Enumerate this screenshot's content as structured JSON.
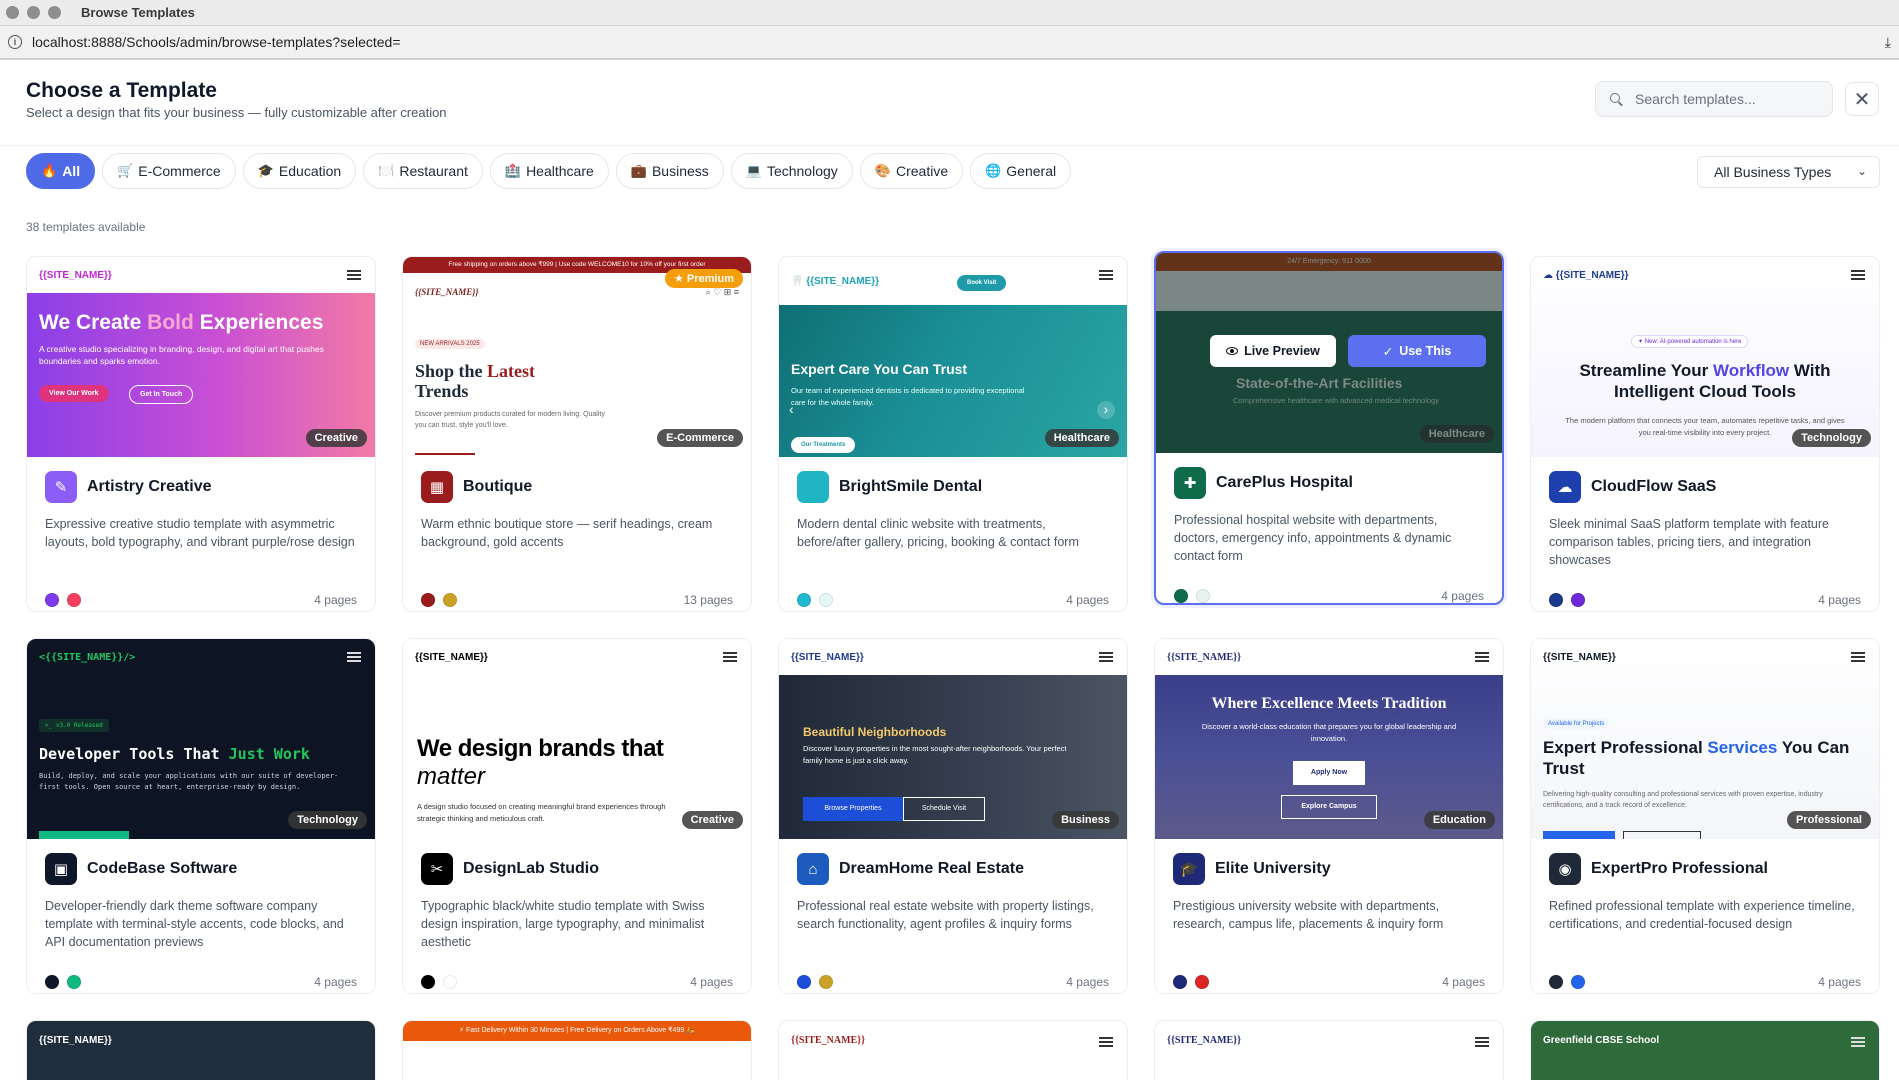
{
  "window": {
    "title": "Browse Templates",
    "url": "localhost:8888/Schools/admin/browse-templates?selected="
  },
  "header": {
    "title": "Choose a Template",
    "subtitle": "Select a design that fits your business — fully customizable after creation",
    "search_placeholder": "Search templates...",
    "close_label": "✕"
  },
  "filters": [
    {
      "emoji": "🔥",
      "label": "All"
    },
    {
      "emoji": "🛒",
      "label": "E-Commerce"
    },
    {
      "emoji": "🎓",
      "label": "Education"
    },
    {
      "emoji": "🍽️",
      "label": "Restaurant"
    },
    {
      "emoji": "🏥",
      "label": "Healthcare"
    },
    {
      "emoji": "💼",
      "label": "Business"
    },
    {
      "emoji": "💻",
      "label": "Technology"
    },
    {
      "emoji": "🎨",
      "label": "Creative"
    },
    {
      "emoji": "🌐",
      "label": "General"
    }
  ],
  "business_select": "All Business Types",
  "count_text": "38 templates available",
  "overlay": {
    "preview": "Live Preview",
    "use": "Use This"
  },
  "cards": [
    {
      "title": "Artistry Creative",
      "desc": "Expressive creative studio template with asymmetric layouts, bold typography, and vibrant purple/rose design",
      "pages": "4 pages",
      "badge": "Creative",
      "icon_color": "#8b5cf6",
      "icon": "✎",
      "swatches": [
        "#7c3aed",
        "#f43f5e"
      ],
      "thumb": {
        "site": "{{SITE_NAME}}",
        "h1a": "We Create ",
        "h1b": "Bold",
        "h1c": " Experiences",
        "p": "A creative studio specializing in branding, design, and digital art that pushes boundaries and sparks emotion.",
        "b1": "View Our Work",
        "b2": "Get In Touch"
      }
    },
    {
      "title": "Boutique",
      "desc": "Warm ethnic boutique store — serif headings, cream background, gold accents",
      "pages": "13 pages",
      "badge": "E-Commerce",
      "premium": "★ Premium",
      "icon_color": "#9b1c1c",
      "icon": "▦",
      "swatches": [
        "#991b1b",
        "#c9a227"
      ],
      "thumb": {
        "bar": "Free shipping on orders above ₹999  |  Use code WELCOME10 for 10% off your first order",
        "site": "{{SITE_NAME}}",
        "tag": "NEW ARRIVALS 2025",
        "h1a": "Shop the ",
        "h1b": "Latest",
        "h1c": "Trends",
        "p": "Discover premium products curated for modern living. Quality you can trust, style you'll love."
      }
    },
    {
      "title": "BrightSmile Dental",
      "desc": "Modern dental clinic website with treatments, before/after gallery, pricing, booking & contact form",
      "pages": "4 pages",
      "badge": "Healthcare",
      "icon_color": "#1fb5c4",
      "icon": "",
      "swatches": [
        "#22b8cf",
        "#e6f7f8"
      ],
      "thumb": {
        "site": "{{SITE_NAME}}",
        "btn": "Book Visit",
        "h1": "Expert Care You Can Trust",
        "p": "Our team of experienced dentists is dedicated to providing exceptional care for the whole family.",
        "b1": "Our Treatments"
      }
    },
    {
      "title": "CarePlus Hospital",
      "desc": "Professional hospital website with departments, doctors, emergency info, appointments & dynamic contact form",
      "pages": "4 pages",
      "badge": "Healthcare",
      "icon_color": "#0f6b4a",
      "icon": "✚",
      "swatches": [
        "#0f6b4a",
        "#e6f3ee"
      ],
      "thumb": {
        "bar": "24/7 Emergency: 911 0000",
        "h1": "State-of-the-Art Facilities",
        "p": "Comprehensive healthcare with advanced medical technology"
      }
    },
    {
      "title": "CloudFlow SaaS",
      "desc": "Sleek minimal SaaS platform template with feature comparison tables, pricing tiers, and integration showcases",
      "pages": "4 pages",
      "badge": "Technology",
      "icon_color": "#1e40af",
      "icon": "☁",
      "swatches": [
        "#1e3a8a",
        "#6d28d9"
      ],
      "thumb": {
        "site": "{{SITE_NAME}}",
        "pill": "✦ New: AI-powered automation is here",
        "h1a": "Streamline Your ",
        "h1b": "Workflow",
        "h1c": " With Intelligent Cloud Tools",
        "p": "The modern platform that connects your team, automates repetitive tasks, and gives you real-time visibility into every project."
      }
    },
    {
      "title": "CodeBase Software",
      "desc": "Developer-friendly dark theme software company template with terminal-style accents, code blocks, and API documentation previews",
      "pages": "4 pages",
      "badge": "Technology",
      "icon_color": "#0f172a",
      "icon": "▣",
      "swatches": [
        "#0f172a",
        "#10b981"
      ],
      "thumb": {
        "site": "<{{SITE_NAME}}/>",
        "tag": ">_ v3.0 Released",
        "h1a": "Developer Tools That ",
        "h1b": "Just Work",
        "p": "Build, deploy, and scale your applications with our suite of developer-first tools. Open source at heart, enterprise-ready by design."
      }
    },
    {
      "title": "DesignLab Studio",
      "desc": "Typographic black/white studio template with Swiss design inspiration, large typography, and minimalist aesthetic",
      "pages": "4 pages",
      "badge": "Creative",
      "icon_color": "#000000",
      "icon": "✂",
      "swatches": [
        "#000000",
        "#ffffff"
      ],
      "thumb": {
        "site": "{{SITE_NAME}}",
        "h1a": "We design brands that",
        "h1b": "matter",
        "p": "A design studio focused on creating meaningful brand experiences through strategic thinking and meticulous craft."
      }
    },
    {
      "title": "DreamHome Real Estate",
      "desc": "Professional real estate website with property listings, search functionality, agent profiles & inquiry forms",
      "pages": "4 pages",
      "badge": "Business",
      "icon_color": "#1e5bbf",
      "icon": "⌂",
      "swatches": [
        "#1d4ed8",
        "#c9a227"
      ],
      "thumb": {
        "site": "{{SITE_NAME}}",
        "h1": "Beautiful Neighborhoods",
        "p": "Discover luxury properties in the most sought-after neighborhoods. Your perfect family home is just a click away.",
        "b1": "Browse Properties",
        "b2": "Schedule Visit"
      }
    },
    {
      "title": "Elite University",
      "desc": "Prestigious university website with departments, research, campus life, placements & inquiry form",
      "pages": "4 pages",
      "badge": "Education",
      "icon_color": "#1e2a78",
      "icon": "🎓",
      "swatches": [
        "#1e2a78",
        "#dc2626"
      ],
      "thumb": {
        "site": "{{SITE_NAME}}",
        "h1": "Where Excellence Meets Tradition",
        "p": "Discover a world-class education that prepares you for global leadership and innovation.",
        "b1": "Apply Now",
        "b2": "Explore Campus"
      }
    },
    {
      "title": "ExpertPro Professional",
      "desc": "Refined professional template with experience timeline, certifications, and credential-focused design",
      "pages": "4 pages",
      "badge": "Professional",
      "icon_color": "#1f2937",
      "icon": "◉",
      "swatches": [
        "#1f2937",
        "#2563eb"
      ],
      "thumb": {
        "site": "{{SITE_NAME}}",
        "tag": "Available for Projects",
        "h1a": "Expert Professional ",
        "h1b": "Services",
        "h1c": " You Can Trust",
        "p": "Delivering high-quality consulting and professional services with proven expertise, industry certifications, and a track record of excellence."
      }
    }
  ],
  "partial_row": [
    {
      "site": "{{SITE_NAME}}"
    },
    {
      "bar": "⚡ Fast Delivery Within 30 Minutes  |  Free Delivery on Orders Above ₹499 🛵"
    },
    {
      "site": "{{SITE_NAME}}"
    },
    {
      "site": "{{SITE_NAME}}"
    },
    {
      "site": "Greenfield CBSE School"
    }
  ]
}
